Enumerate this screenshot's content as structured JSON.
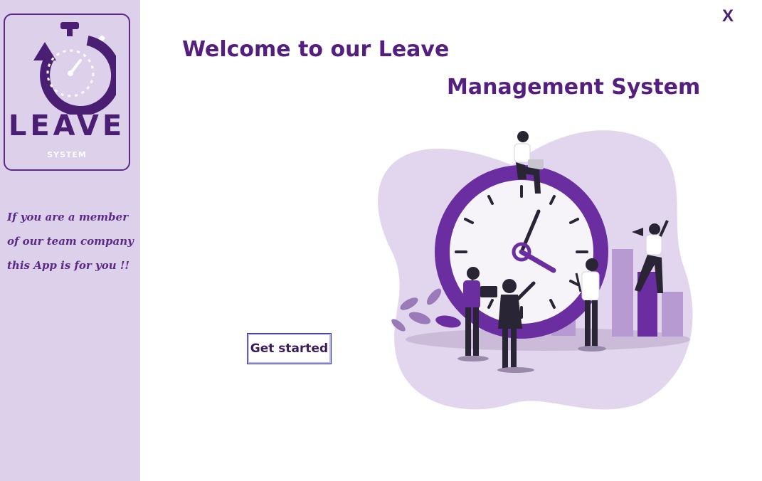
{
  "logo": {
    "word": "LEAVE",
    "sub": "SYSTEM"
  },
  "sidebar": {
    "tagline_lines": [
      "If you are a member",
      "of our team company",
      "this App is for you !!"
    ]
  },
  "window": {
    "close_label": "X"
  },
  "main": {
    "title_line1": "Welcome to our Leave",
    "title_line2": "Management System",
    "get_started_label": "Get started"
  },
  "colors": {
    "sidebar_bg": "#dcd0ea",
    "brand_purple": "#551f80",
    "accent_purple": "#6a2ea0",
    "blob_lilac": "#e2d6ee"
  },
  "icons": {
    "logo_icon": "stopwatch-icon",
    "close_icon": "close-icon",
    "hero": "clock-team-illustration"
  }
}
